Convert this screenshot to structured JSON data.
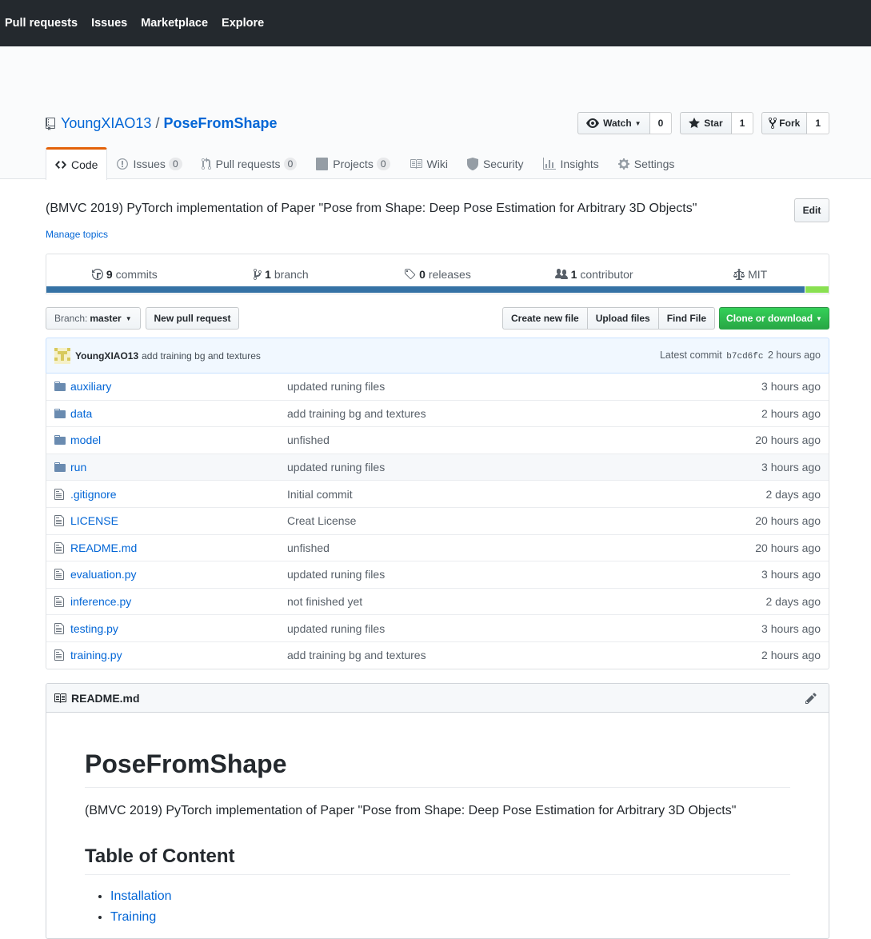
{
  "topnav": {
    "pull_requests": "Pull requests",
    "issues": "Issues",
    "marketplace": "Marketplace",
    "explore": "Explore"
  },
  "repo": {
    "owner": "YoungXIAO13",
    "separator": "/",
    "name": "PoseFromShape"
  },
  "actions": {
    "watch_label": "Watch",
    "watch_count": "0",
    "star_label": "Star",
    "star_count": "1",
    "fork_label": "Fork",
    "fork_count": "1"
  },
  "tabs": [
    {
      "label": "Code",
      "icon": "code-icon"
    },
    {
      "label": "Issues",
      "counter": "0",
      "icon": "issue-icon"
    },
    {
      "label": "Pull requests",
      "counter": "0",
      "icon": "pull-request-icon"
    },
    {
      "label": "Projects",
      "counter": "0",
      "icon": "project-icon"
    },
    {
      "label": "Wiki",
      "icon": "book-icon"
    },
    {
      "label": "Security",
      "icon": "shield-icon"
    },
    {
      "label": "Insights",
      "icon": "graph-icon"
    },
    {
      "label": "Settings",
      "icon": "gear-icon"
    }
  ],
  "description": "(BMVC 2019) PyTorch implementation of Paper \"Pose from Shape: Deep Pose Estimation for Arbitrary 3D Objects\"",
  "edit_label": "Edit",
  "manage_topics": "Manage topics",
  "summary": {
    "commits_count": "9",
    "commits_label": "commits",
    "branch_count": "1",
    "branch_label": "branch",
    "releases_count": "0",
    "releases_label": "releases",
    "contributor_count": "1",
    "contributor_label": "contributor",
    "license": "MIT"
  },
  "languages": [
    {
      "color": "#3572A5",
      "fraction": 0.97
    },
    {
      "color": "#89e051",
      "fraction": 0.03
    }
  ],
  "branch": {
    "prefix": "Branch:",
    "name": "master"
  },
  "buttons": {
    "new_pull_request": "New pull request",
    "create_new_file": "Create new file",
    "upload_files": "Upload files",
    "find_file": "Find File",
    "clone": "Clone or download"
  },
  "latest_commit": {
    "author": "YoungXIAO13",
    "message": "add training bg and textures",
    "prefix": "Latest commit",
    "sha": "b7cd6fc",
    "age": "2 hours ago"
  },
  "files": [
    {
      "name": "auxiliary",
      "type": "dir",
      "message": "updated runing files",
      "age": "3 hours ago"
    },
    {
      "name": "data",
      "type": "dir",
      "message": "add training bg and textures",
      "age": "2 hours ago"
    },
    {
      "name": "model",
      "type": "dir",
      "message": "unfished",
      "age": "20 hours ago"
    },
    {
      "name": "run",
      "type": "dir",
      "message": "updated runing files",
      "age": "3 hours ago"
    },
    {
      "name": ".gitignore",
      "type": "file",
      "message": "Initial commit",
      "age": "2 days ago"
    },
    {
      "name": "LICENSE",
      "type": "file",
      "message": "Creat License",
      "age": "20 hours ago"
    },
    {
      "name": "README.md",
      "type": "file",
      "message": "unfished",
      "age": "20 hours ago"
    },
    {
      "name": "evaluation.py",
      "type": "file",
      "message": "updated runing files",
      "age": "3 hours ago"
    },
    {
      "name": "inference.py",
      "type": "file",
      "message": "not finished yet",
      "age": "2 days ago"
    },
    {
      "name": "testing.py",
      "type": "file",
      "message": "updated runing files",
      "age": "3 hours ago"
    },
    {
      "name": "training.py",
      "type": "file",
      "message": "add training bg and textures",
      "age": "2 hours ago"
    }
  ],
  "readme": {
    "filename": "README.md",
    "h1": "PoseFromShape",
    "intro": "(BMVC 2019) PyTorch implementation of Paper \"Pose from Shape: Deep Pose Estimation for Arbitrary 3D Objects\"",
    "toc_title": "Table of Content",
    "toc": [
      "Installation",
      "Training"
    ]
  }
}
